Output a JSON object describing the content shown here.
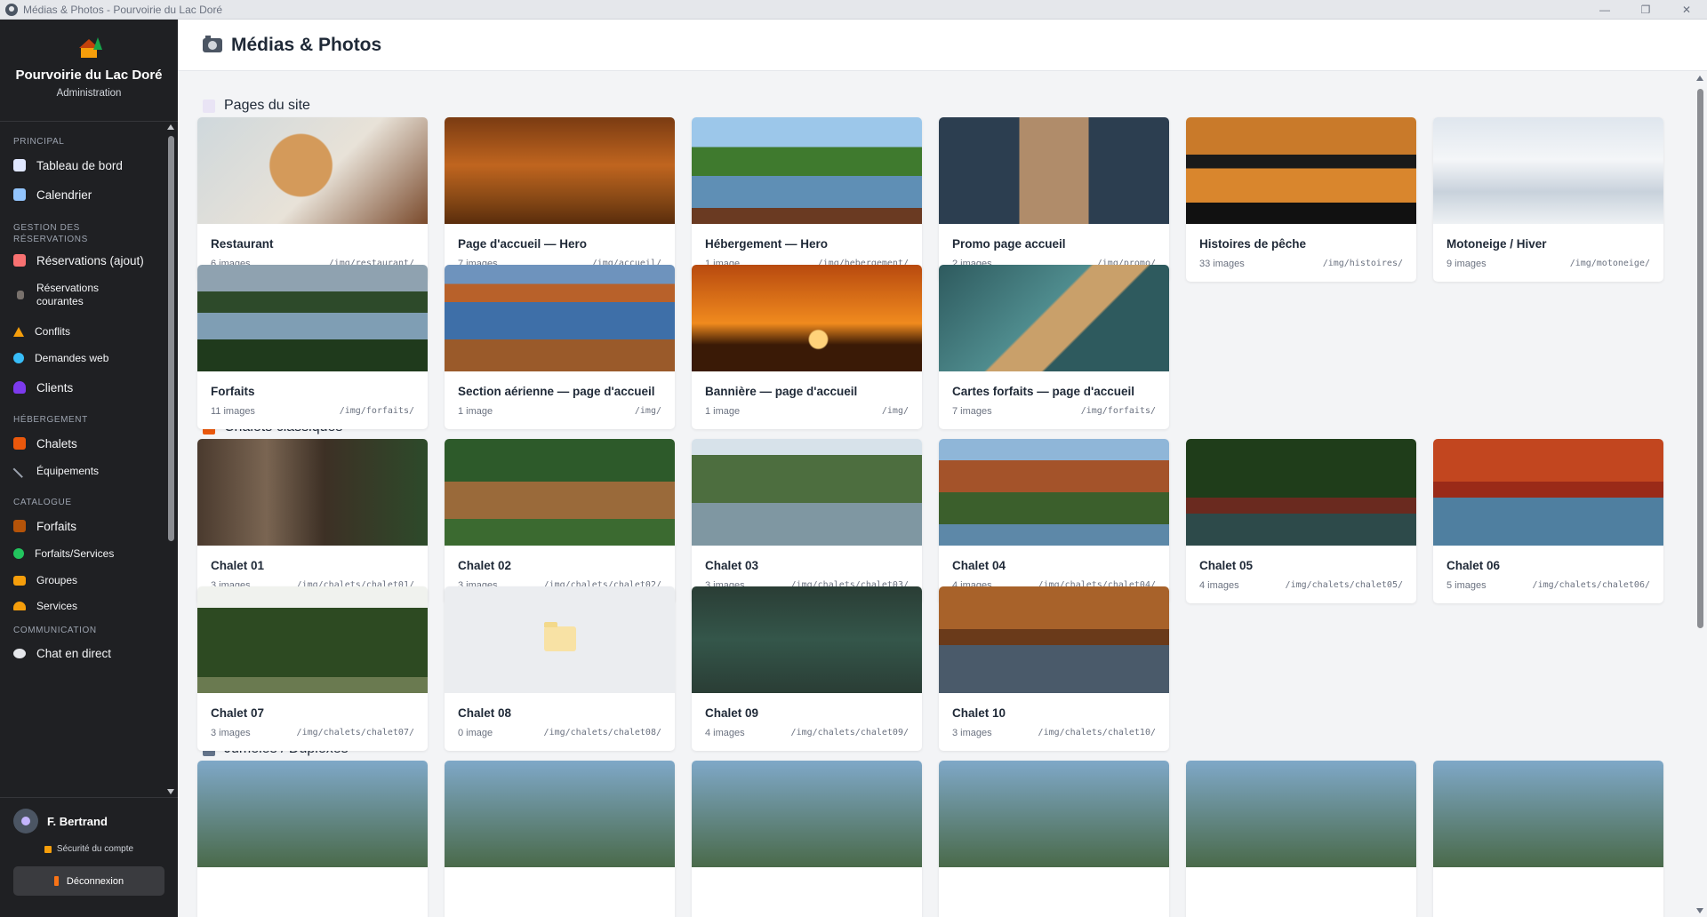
{
  "window": {
    "title": "Médias & Photos - Pourvoirie du Lac Doré"
  },
  "brand": {
    "name": "Pourvoirie du Lac Doré",
    "subtitle": "Administration"
  },
  "nav": {
    "principal": "PRINCIPAL",
    "dashboard": "Tableau de bord",
    "calendar": "Calendrier",
    "gestion_line1": "GESTION DES",
    "gestion_line2": "RÉSERVATIONS",
    "reservations_add": "Réservations (ajout)",
    "reservations_current_1": "Réservations",
    "reservations_current_2": "courantes",
    "conflicts": "Conflits",
    "web_requests": "Demandes web",
    "clients": "Clients",
    "hebergement": "HÉBERGEMENT",
    "chalets": "Chalets",
    "equipements": "Équipements",
    "catalogue": "CATALOGUE",
    "forfaits": "Forfaits",
    "forfaits_services": "Forfaits/Services",
    "groupes": "Groupes",
    "services": "Services",
    "communication": "COMMUNICATION",
    "chat": "Chat en direct"
  },
  "user": {
    "name": "F. Bertrand",
    "security": "Sécurité du compte",
    "logout": "Déconnexion"
  },
  "page": {
    "title": "Médias & Photos"
  },
  "sections": [
    {
      "title": "Pages du site",
      "cards": [
        {
          "name": "Restaurant",
          "count": "6 images",
          "path": "/img/restaurant/"
        },
        {
          "name": "Page d'accueil — Hero",
          "count": "7 images",
          "path": "/img/accueil/"
        },
        {
          "name": "Hébergement — Hero",
          "count": "1 image",
          "path": "/img/hebergement/"
        },
        {
          "name": "Promo page accueil",
          "count": "2 images",
          "path": "/img/promo/"
        },
        {
          "name": "Histoires de pêche",
          "count": "33 images",
          "path": "/img/histoires/"
        },
        {
          "name": "Motoneige / Hiver",
          "count": "9 images",
          "path": "/img/motoneige/"
        },
        {
          "name": "Forfaits",
          "count": "11 images",
          "path": "/img/forfaits/"
        },
        {
          "name": "Section aérienne — page d'accueil",
          "count": "1 image",
          "path": "/img/"
        },
        {
          "name": "Bannière — page d'accueil",
          "count": "1 image",
          "path": "/img/"
        },
        {
          "name": "Cartes forfaits — page d'accueil",
          "count": "7 images",
          "path": "/img/forfaits/"
        }
      ]
    },
    {
      "title": "Chalets classiques",
      "cards": [
        {
          "name": "Chalet 01",
          "count": "3 images",
          "path": "/img/chalets/chalet01/"
        },
        {
          "name": "Chalet 02",
          "count": "3 images",
          "path": "/img/chalets/chalet02/"
        },
        {
          "name": "Chalet 03",
          "count": "3 images",
          "path": "/img/chalets/chalet03/"
        },
        {
          "name": "Chalet 04",
          "count": "4 images",
          "path": "/img/chalets/chalet04/"
        },
        {
          "name": "Chalet 05",
          "count": "4 images",
          "path": "/img/chalets/chalet05/"
        },
        {
          "name": "Chalet 06",
          "count": "5 images",
          "path": "/img/chalets/chalet06/"
        },
        {
          "name": "Chalet 07",
          "count": "3 images",
          "path": "/img/chalets/chalet07/"
        },
        {
          "name": "Chalet 08",
          "count": "0 image",
          "path": "/img/chalets/chalet08/"
        },
        {
          "name": "Chalet 09",
          "count": "4 images",
          "path": "/img/chalets/chalet09/"
        },
        {
          "name": "Chalet 10",
          "count": "3 images",
          "path": "/img/chalets/chalet10/"
        }
      ]
    },
    {
      "title": "Jumelés / Duplexes"
    }
  ]
}
